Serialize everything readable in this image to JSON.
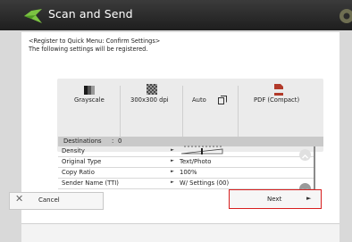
{
  "app": {
    "title": "Scan and Send"
  },
  "message": {
    "line1": "<Register to Quick Menu: Confirm Settings>",
    "line2": "The following settings will be registered."
  },
  "summary": [
    {
      "label": "Grayscale",
      "icon": "grayscale-icon"
    },
    {
      "label": "300x300 dpi",
      "icon": "resolution-icon"
    },
    {
      "label": "Auto",
      "icon": ""
    },
    {
      "label": "",
      "icon": "copy-sides-icon"
    },
    {
      "label": "PDF (Compact)",
      "icon": "pdf-file-icon"
    }
  ],
  "destinations": {
    "label": "Destinations",
    "sep": ":",
    "count": "0"
  },
  "settings": [
    {
      "key": "Density",
      "value": ""
    },
    {
      "key": "Original Type",
      "value": "Text/Photo"
    },
    {
      "key": "Copy Ratio",
      "value": "100%"
    },
    {
      "key": "Sender Name (TTI)",
      "value": "W/ Settings (00)"
    }
  ],
  "buttons": {
    "cancel": "Cancel",
    "next": "Next"
  },
  "colors": {
    "next_border": "#d81f1f",
    "titlebar": "#2a2a2a"
  }
}
